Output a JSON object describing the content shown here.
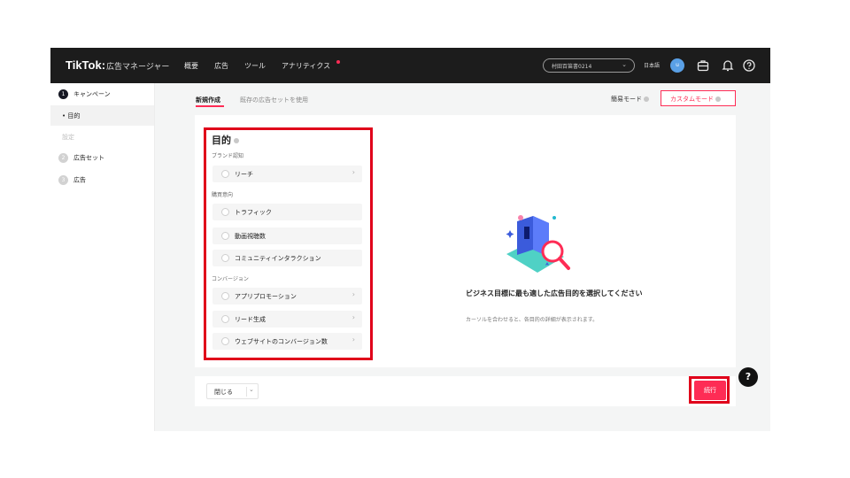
{
  "header": {
    "logo": "TikTok:",
    "logo_sub": "広告マネージャー",
    "nav": [
      "概要",
      "広告",
      "ツール",
      "アナリティクス"
    ],
    "account": "村田百笛書0214",
    "lang": "日本語",
    "avatar_initial": "u"
  },
  "sidebar": {
    "steps": [
      {
        "num": "1",
        "label": "キャンペーン"
      },
      {
        "num": "2",
        "label": "広告セット"
      },
      {
        "num": "3",
        "label": "広告"
      }
    ],
    "sub_active": "• 目的",
    "sub_disabled": "設定"
  },
  "tabs": {
    "new": "新規作成",
    "existing": "既存の広告セットを使用"
  },
  "modes": {
    "simple": "簡易モード",
    "custom": "カスタムモード"
  },
  "objective": {
    "title": "目的",
    "groups": [
      {
        "label": "ブランド認知",
        "items": [
          {
            "label": "リーチ",
            "arrow": true
          }
        ]
      },
      {
        "label": "購買意向",
        "items": [
          {
            "label": "トラフィック",
            "arrow": false
          },
          {
            "label": "動画視聴数",
            "arrow": false
          },
          {
            "label": "コミュニティインタラクション",
            "arrow": false
          }
        ]
      },
      {
        "label": "コンバージョン",
        "items": [
          {
            "label": "アプリプロモーション",
            "arrow": true
          },
          {
            "label": "リード生成",
            "arrow": true
          },
          {
            "label": "ウェブサイトのコンバージョン数",
            "arrow": true
          }
        ]
      }
    ]
  },
  "hint": {
    "title": "ビジネス目標に最も適した広告目的を選択してください",
    "text": "カーソルを合わせると、各目的の詳細が表示されます。"
  },
  "footer": {
    "close": "閉じる",
    "continue": "続行",
    "help": "?"
  },
  "colors": {
    "accent": "#fe2c55",
    "highlight": "#e0001a",
    "topbar": "#1c1c1c"
  }
}
